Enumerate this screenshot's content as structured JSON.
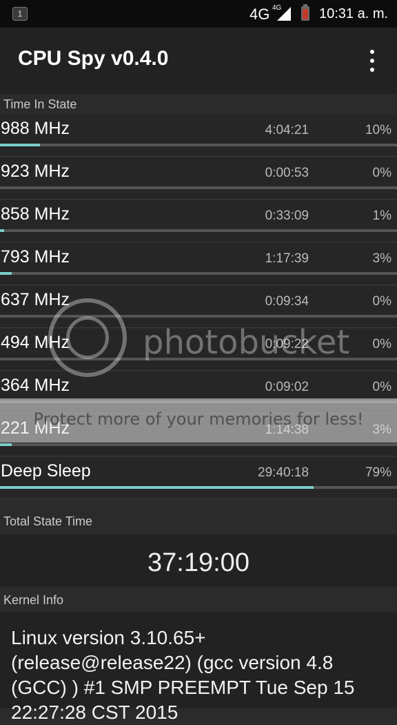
{
  "status_bar": {
    "notification_count": "1",
    "network": "4G",
    "network_small": "4G",
    "clock": "10:31 a. m."
  },
  "app": {
    "title": "CPU Spy v0.4.0",
    "overflow_icon": "more-vert-icon"
  },
  "time_in_state": {
    "header": "Time In State",
    "rows": [
      {
        "label": "988 MHz",
        "time": "4:04:21",
        "percent": "10%",
        "fraction": 0.1
      },
      {
        "label": "923 MHz",
        "time": "0:00:53",
        "percent": "0%",
        "fraction": 0.0
      },
      {
        "label": "858 MHz",
        "time": "0:33:09",
        "percent": "1%",
        "fraction": 0.01
      },
      {
        "label": "793 MHz",
        "time": "1:17:39",
        "percent": "3%",
        "fraction": 0.03
      },
      {
        "label": "637 MHz",
        "time": "0:09:34",
        "percent": "0%",
        "fraction": 0.0
      },
      {
        "label": "494 MHz",
        "time": "0:09:22",
        "percent": "0%",
        "fraction": 0.0
      },
      {
        "label": "364 MHz",
        "time": "0:09:02",
        "percent": "0%",
        "fraction": 0.0
      },
      {
        "label": "221 MHz",
        "time": "1:14:38",
        "percent": "3%",
        "fraction": 0.03
      },
      {
        "label": "Deep Sleep",
        "time": "29:40:18",
        "percent": "79%",
        "fraction": 0.79
      }
    ]
  },
  "total_state_time": {
    "header": "Total State Time",
    "value": "37:19:00"
  },
  "kernel_info": {
    "header": "Kernel Info",
    "text": "Linux version 3.10.65+ (release@release22) (gcc version 4.8 (GCC) ) #1 SMP PREEMPT Tue Sep 15 22:27:28 CST 2015"
  },
  "watermark": {
    "brand": "photobucket",
    "promo": "Protect more of your memories for less!"
  },
  "colors": {
    "accent": "#79cfc9",
    "background": "#2b2b2b",
    "action_bar": "#222222",
    "status_bar": "#0c0c0c"
  }
}
